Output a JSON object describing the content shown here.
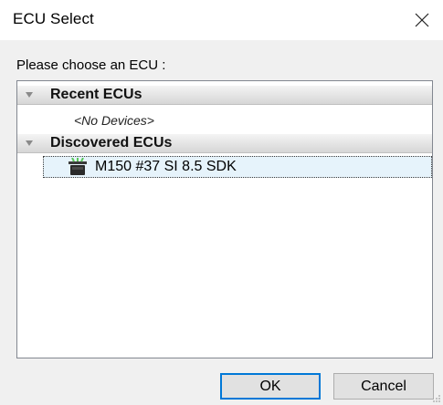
{
  "window": {
    "title": "ECU Select",
    "close_icon": "close-icon"
  },
  "prompt": "Please choose an ECU :",
  "tree": {
    "groups": [
      {
        "label": "Recent ECUs",
        "expanded": true,
        "empty_text": "<No Devices>"
      },
      {
        "label": "Discovered ECUs",
        "expanded": true,
        "items": [
          {
            "label": "M150 #37 SI 8.5 SDK",
            "icon": "ecu-device-icon",
            "selected": true
          }
        ]
      }
    ]
  },
  "buttons": {
    "ok": "OK",
    "cancel": "Cancel"
  },
  "colors": {
    "accent": "#0078d7",
    "selection_bg": "#e6f3fb",
    "group_header_bg": "#dcdcdc",
    "dialog_bg": "#f0f0f0"
  }
}
